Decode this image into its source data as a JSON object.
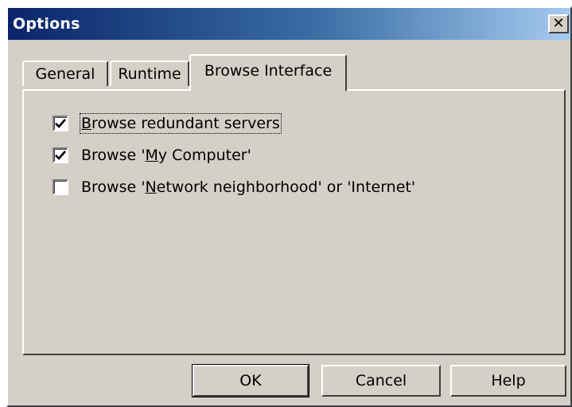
{
  "window": {
    "title": "Options",
    "close_glyph": "✕"
  },
  "tabs": [
    {
      "label": "General",
      "active": false
    },
    {
      "label": "Runtime",
      "active": false
    },
    {
      "label": "Browse Interface",
      "active": true
    }
  ],
  "options": [
    {
      "pre": "",
      "mnemonic": "B",
      "post": "rowse redundant servers",
      "checked": true,
      "focused": true
    },
    {
      "pre": "Browse '",
      "mnemonic": "M",
      "post": "y Computer'",
      "checked": true,
      "focused": false
    },
    {
      "pre": "Browse '",
      "mnemonic": "N",
      "post": "etwork neighborhood' or 'Internet'",
      "checked": false,
      "focused": false
    }
  ],
  "buttons": {
    "ok": "OK",
    "cancel": "Cancel",
    "help": "Help"
  },
  "colors": {
    "face": "#d4d0c8",
    "title_start": "#0a246a",
    "title_end": "#a6caf0"
  }
}
